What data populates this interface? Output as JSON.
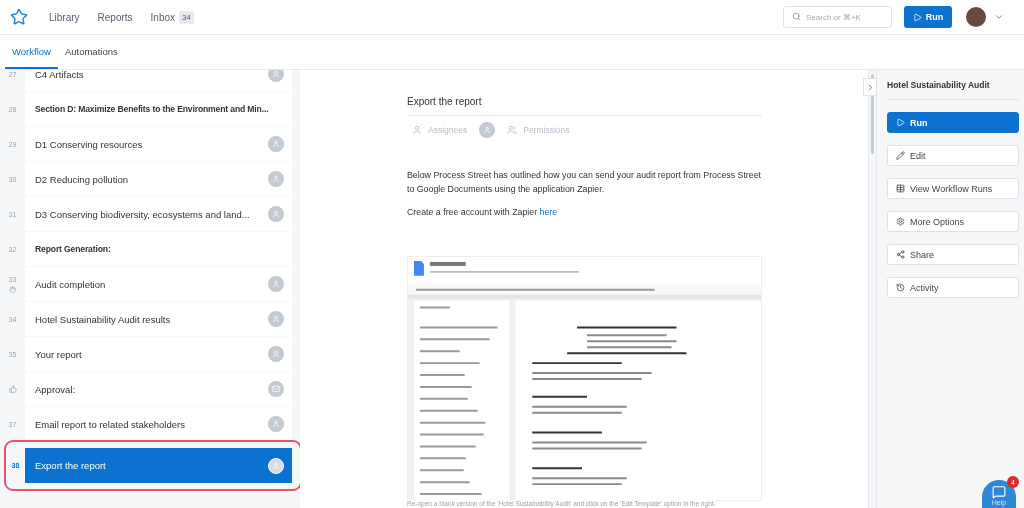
{
  "topbar": {
    "nav": [
      {
        "label": "Library"
      },
      {
        "label": "Reports"
      },
      {
        "label": "Inbox",
        "count": "34"
      }
    ],
    "search": {
      "placeholder": "Search or ⌘+K"
    },
    "run_button": "Run"
  },
  "tabs": [
    {
      "label": "Workflow",
      "selected": true
    },
    {
      "label": "Automations",
      "selected": false
    }
  ],
  "tasks": [
    {
      "kind": "task",
      "number": "27",
      "label": "C4 Artifacts",
      "selected": false,
      "stop_task": false
    },
    {
      "kind": "heading",
      "number": "28",
      "label": "Section D: Maximize Benefits to the Environment and Min...",
      "selected": false,
      "stop_task": false
    },
    {
      "kind": "task",
      "number": "29",
      "label": "D1 Conserving resources",
      "selected": false,
      "stop_task": false
    },
    {
      "kind": "task",
      "number": "30",
      "label": "D2 Reducing pollution",
      "selected": false,
      "stop_task": false
    },
    {
      "kind": "task",
      "number": "31",
      "label": "D3 Conserving biodiversity, ecosystems and land...",
      "selected": false,
      "stop_task": false
    },
    {
      "kind": "heading",
      "number": "32",
      "label": "Report Generation:",
      "selected": false,
      "stop_task": false
    },
    {
      "kind": "task",
      "number": "33",
      "label": "Audit completion",
      "selected": false,
      "stop_task": true
    },
    {
      "kind": "task",
      "number": "34",
      "label": "Hotel Sustainability Audit results",
      "selected": false,
      "stop_task": false
    },
    {
      "kind": "task",
      "number": "35",
      "label": "Your report",
      "selected": false,
      "stop_task": false
    },
    {
      "kind": "approval",
      "label": "Approval:",
      "selected": false,
      "stop_task": false
    },
    {
      "kind": "task",
      "number": "37",
      "label": "Email report to related stakeholders",
      "selected": false,
      "stop_task": false
    },
    {
      "kind": "task",
      "number": "38",
      "label": "Export the report",
      "selected": true,
      "stop_task": false
    }
  ],
  "content": {
    "title": "Export the report",
    "assignees": "Assignees",
    "permissions": "Permissions",
    "paragraphs": [
      "Below Process Street has outlined how you can send your audit report from Process Street to Google Documents using the application Zapier."
    ],
    "signup_text": "Create a free account with Zapier",
    "signup_link": "here",
    "image": {
      "kind": "picture"
    },
    "footer_text": "Re-open a blank version of the 'Hotel Sustainability Audit' and click on the 'Edit Template' option in the right-"
  },
  "panel": {
    "title": "Hotel Sustainability Audit",
    "actions": [
      {
        "kind": "primary",
        "label": "Run"
      },
      {
        "kind": "secondary",
        "label": "Edit"
      },
      {
        "kind": "secondary",
        "label": "View Workflow Runs"
      },
      {
        "kind": "secondary",
        "label": "More Options"
      },
      {
        "kind": "secondary",
        "label": "Share"
      },
      {
        "kind": "secondary",
        "label": "Activity"
      }
    ]
  },
  "help": {
    "label": "Help",
    "badge": "4"
  }
}
